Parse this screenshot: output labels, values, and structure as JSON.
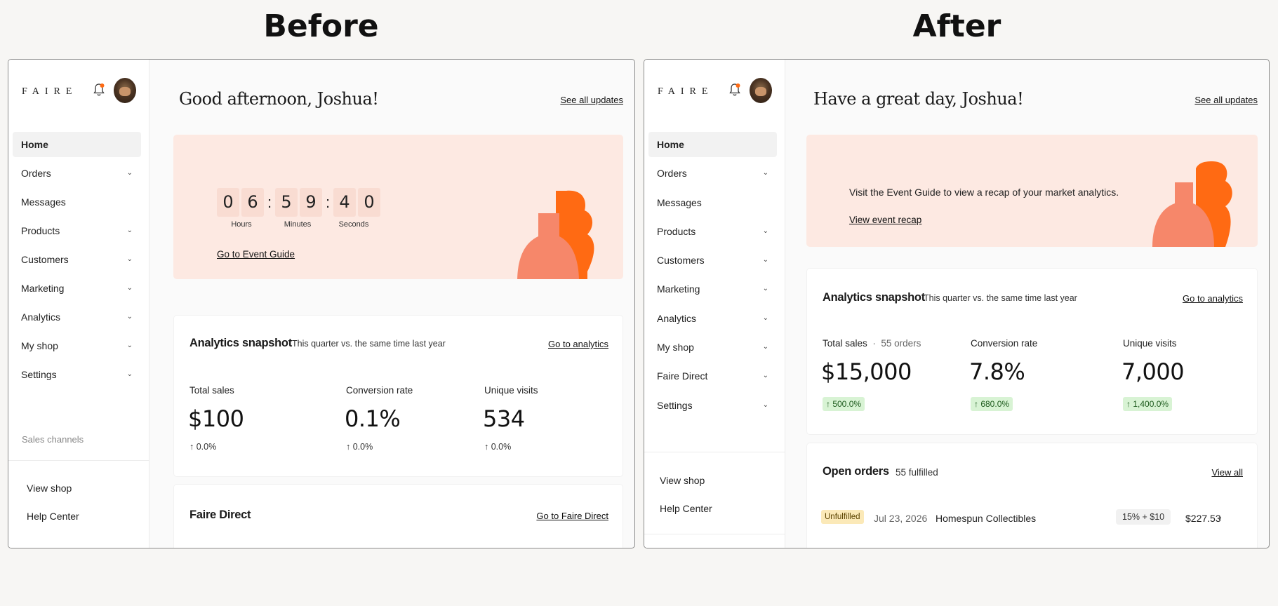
{
  "headings": {
    "before": "Before",
    "after": "After"
  },
  "brand": "FAIRE",
  "colors": {
    "accent_orange": "#ff6a13",
    "banner_bg": "#fde9e2",
    "peach_shape": "#f6876a",
    "positive_pill": "#d8f3d4",
    "unfulfilled_badge": "#fbe9b8"
  },
  "before": {
    "nav": [
      {
        "label": "Home",
        "active": true,
        "chevron": false
      },
      {
        "label": "Orders",
        "chevron": true
      },
      {
        "label": "Messages",
        "chevron": false
      },
      {
        "label": "Products",
        "chevron": true
      },
      {
        "label": "Customers",
        "chevron": true
      },
      {
        "label": "Marketing",
        "chevron": true
      },
      {
        "label": "Analytics",
        "chevron": true
      },
      {
        "label": "My shop",
        "chevron": true
      },
      {
        "label": "Settings",
        "chevron": true
      }
    ],
    "sales_channels_label": "Sales channels",
    "view_shop": "View shop",
    "help_center": "Help Center",
    "greeting": "Good afternoon, Joshua!",
    "see_all_updates": "See all updates",
    "countdown": {
      "digits": [
        "0",
        "6",
        "5",
        "9",
        "4",
        "0"
      ],
      "separator": ":",
      "labels": {
        "hours": "Hours",
        "minutes": "Minutes",
        "seconds": "Seconds"
      }
    },
    "event_link": "Go to Event Guide",
    "analytics": {
      "title": "Analytics snapshot",
      "subtitle": "This quarter vs. the same time last year",
      "link": "Go to analytics",
      "metrics": [
        {
          "label": "Total sales",
          "value": "$100",
          "delta": "↑ 0.0%"
        },
        {
          "label": "Conversion rate",
          "value": "0.1%",
          "delta": "↑ 0.0%"
        },
        {
          "label": "Unique visits",
          "value": "534",
          "delta": "↑ 0.0%"
        }
      ]
    },
    "faire_direct": {
      "title": "Faire Direct",
      "link": "Go to Faire Direct"
    }
  },
  "after": {
    "nav": [
      {
        "label": "Home",
        "active": true,
        "chevron": false
      },
      {
        "label": "Orders",
        "chevron": true
      },
      {
        "label": "Messages",
        "chevron": false
      },
      {
        "label": "Products",
        "chevron": true
      },
      {
        "label": "Customers",
        "chevron": true
      },
      {
        "label": "Marketing",
        "chevron": true
      },
      {
        "label": "Analytics",
        "chevron": true
      },
      {
        "label": "My shop",
        "chevron": true
      },
      {
        "label": "Faire Direct",
        "chevron": true
      },
      {
        "label": "Settings",
        "chevron": true
      }
    ],
    "view_shop": "View shop",
    "help_center": "Help Center",
    "greeting": "Have a great day, Joshua!",
    "see_all_updates": "See all updates",
    "banner_text": "Visit the Event Guide to view a recap of your market analytics.",
    "banner_link": "View event recap",
    "analytics": {
      "title": "Analytics snapshot",
      "subtitle": "This quarter vs. the same time last year",
      "link": "Go to analytics",
      "metrics": [
        {
          "label": "Total sales",
          "sub": "55 orders",
          "value": "$15,000",
          "delta": "↑ 500.0%"
        },
        {
          "label": "Conversion rate",
          "value": "7.8%",
          "delta": "↑ 680.0%"
        },
        {
          "label": "Unique visits",
          "value": "7,000",
          "delta": "↑ 1,400.0%"
        }
      ]
    },
    "open_orders": {
      "title": "Open orders",
      "subtitle": "55 fulfilled",
      "link": "View all",
      "row": {
        "status": "Unfulfilled",
        "date": "Jul 23, 2026",
        "retailer": "Homespun Collectibles",
        "fee": "15% + $10",
        "amount": "$227.53"
      }
    }
  }
}
